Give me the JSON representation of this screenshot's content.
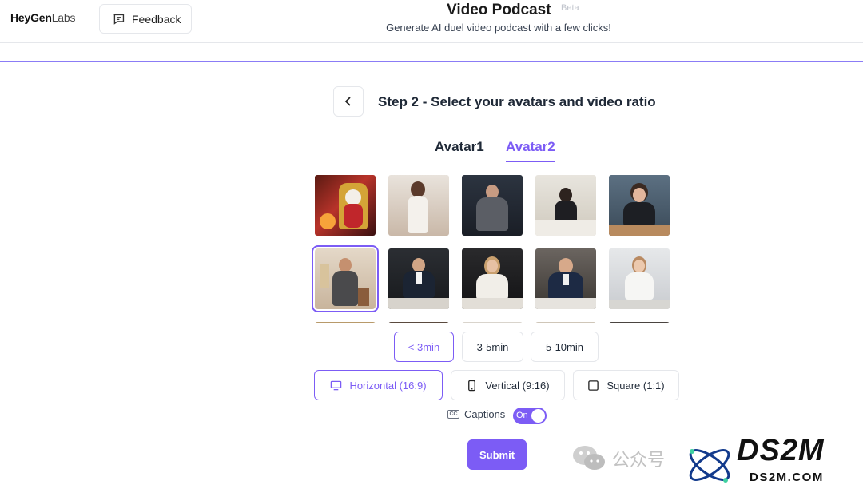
{
  "header": {
    "logo_bold": "HeyGen",
    "logo_light": "Labs",
    "feedback_label": "Feedback",
    "title": "Video Podcast",
    "badge": "Beta",
    "subtitle": "Generate AI duel video podcast with a few clicks!"
  },
  "step": {
    "title": "Step 2 - Select your avatars and video ratio"
  },
  "tabs": [
    {
      "label": "Avatar1",
      "active": false
    },
    {
      "label": "Avatar2",
      "active": true
    }
  ],
  "avatars": {
    "selected_index": 5,
    "count_visible": 10
  },
  "duration": {
    "options": [
      "< 3min",
      "3-5min",
      "5-10min"
    ],
    "selected": "< 3min"
  },
  "ratio": {
    "options": [
      "Horizontal (16:9)",
      "Vertical (9:16)",
      "Square (1:1)"
    ],
    "selected": "Horizontal (16:9)"
  },
  "captions": {
    "label": "Captions",
    "cc": "CC",
    "state": "On"
  },
  "submit_label": "Submit",
  "watermark": {
    "text": "公众号",
    "brand": "DS2M",
    "url": "DS2M.COM"
  },
  "colors": {
    "accent": "#7c5cf5",
    "border": "#e5e7eb"
  }
}
